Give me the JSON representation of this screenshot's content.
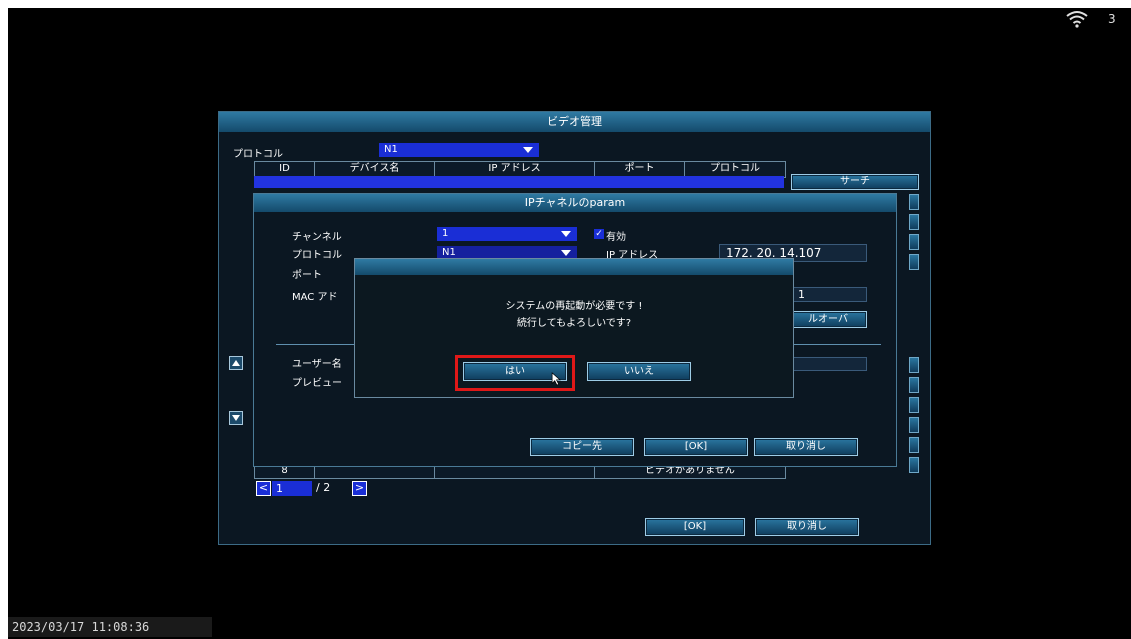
{
  "status": {
    "wifi_icon": "wifi-icon",
    "wifi_count": "3",
    "timestamp": "2023/03/17 11:08:36"
  },
  "video_mgmt": {
    "title": "ビデオ管理",
    "protocol_label": "プロトコル",
    "protocol_value": "N1",
    "columns": [
      "ID",
      "デバイス名",
      "IP アドレス",
      "ポート",
      "プロトコル"
    ],
    "search_button": "サーチ",
    "last_row": {
      "id": "8",
      "name": "",
      "ip": "",
      "port": "ビデオがありません",
      "protocol": ""
    },
    "page_current": "1",
    "page_total": "/ 2",
    "ok_button": "[OK]",
    "cancel_button": "取り消し"
  },
  "ip_channel": {
    "title": "IPチャネルのparam",
    "channel_label": "チャンネル",
    "channel_value": "1",
    "enabled_label": "有効",
    "protocol_label": "プロトコル",
    "protocol_value": "N1",
    "ip_label": "IP アドレス",
    "ip_value": "172. 20. 14.107",
    "port_label": "ポート",
    "mac_label": "MAC アド",
    "mac_value_partial": "1",
    "failover_partial": "ルオーバ",
    "user_label": "ユーザー名",
    "preview_label": "プレビュー",
    "copy_button": "コピー先",
    "ok_button": "[OK]",
    "cancel_button": "取り消し"
  },
  "confirm": {
    "line1": "システムの再起動が必要です !",
    "line2": "続行してもよろしいです?",
    "yes_button": "はい",
    "no_button": "いいえ",
    "highlight_color": "#e01818"
  }
}
